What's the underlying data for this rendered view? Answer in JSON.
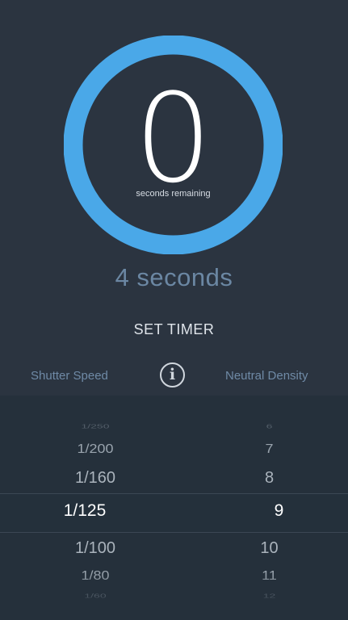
{
  "timer": {
    "remaining_value": "0",
    "remaining_label": "seconds remaining",
    "progress_fraction": 1.0,
    "ring_color": "#4aa8e8"
  },
  "duration_text": "4 seconds",
  "set_timer_label": "SET TIMER",
  "columns": {
    "shutter_label": "Shutter Speed",
    "nd_label": "Neutral Density",
    "info_icon": "info-icon"
  },
  "picker": {
    "shutter": [
      "1/250",
      "1/200",
      "1/160",
      "1/125",
      "1/100",
      "1/80",
      "1/60"
    ],
    "nd": [
      "6",
      "7",
      "8",
      "9",
      "10",
      "11",
      "12"
    ],
    "selected_shutter": "1/125",
    "selected_nd": "9"
  }
}
